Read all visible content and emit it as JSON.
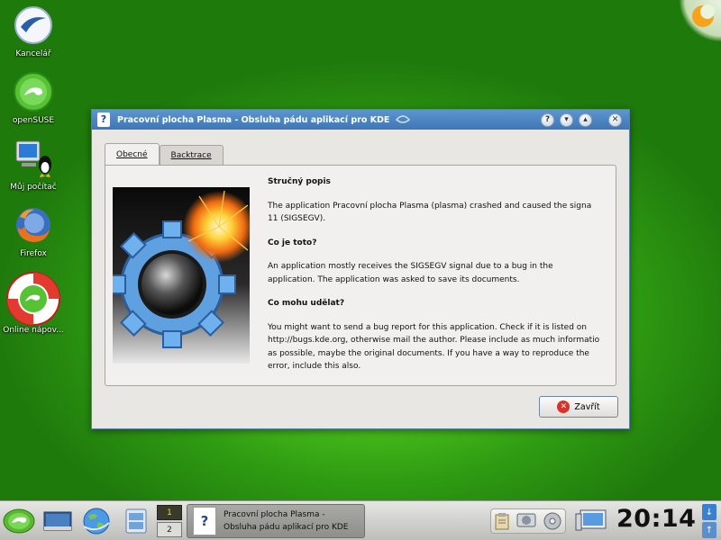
{
  "desktop": {
    "icons": [
      {
        "label": "Kancelář",
        "icon": "office-icon"
      },
      {
        "label": "openSUSE",
        "icon": "opensuse-icon"
      },
      {
        "label": "Můj počítač",
        "icon": "my-computer-icon"
      },
      {
        "label": "Firefox",
        "icon": "firefox-icon"
      },
      {
        "label": "Online nápov...",
        "icon": "online-help-icon"
      }
    ],
    "background_color": "#3fb317"
  },
  "dialog": {
    "title": "Pracovní plocha Plasma - Obsluha pádu aplikací pro KDE",
    "titlebar_buttons": [
      "help-icon",
      "minimize-icon",
      "maximize-icon",
      "close-icon"
    ],
    "tabs": [
      {
        "label": "Obecné",
        "active": true
      },
      {
        "label": "Backtrace",
        "active": false
      }
    ],
    "sections": [
      {
        "heading": "Stručný popis",
        "lines": [
          "The application Pracovní plocha Plasma (plasma) crashed and caused the signa",
          "11 (SIGSEGV)."
        ]
      },
      {
        "heading": "Co je toto?",
        "lines": [
          "An application mostly receives the SIGSEGV signal due to a bug in the",
          "application. The application was asked to save its documents."
        ]
      },
      {
        "heading": "Co mohu udělat?",
        "lines": [
          "You might want to send a bug report for this application. Check if it is listed on",
          "http://bugs.kde.org, otherwise mail the author. Please include as much informatio",
          "as possible, maybe the original documents. If you have a way to reproduce the",
          "error, include this also."
        ]
      }
    ],
    "close_button": "Zavřít",
    "accent_color": "#4a85c4"
  },
  "taskbar": {
    "pager": [
      "1",
      "2"
    ],
    "task": {
      "line1": "Pracovní plocha Plasma -",
      "line2": "Obsluha pádu aplikací pro KDE"
    },
    "clock": "20:14"
  }
}
